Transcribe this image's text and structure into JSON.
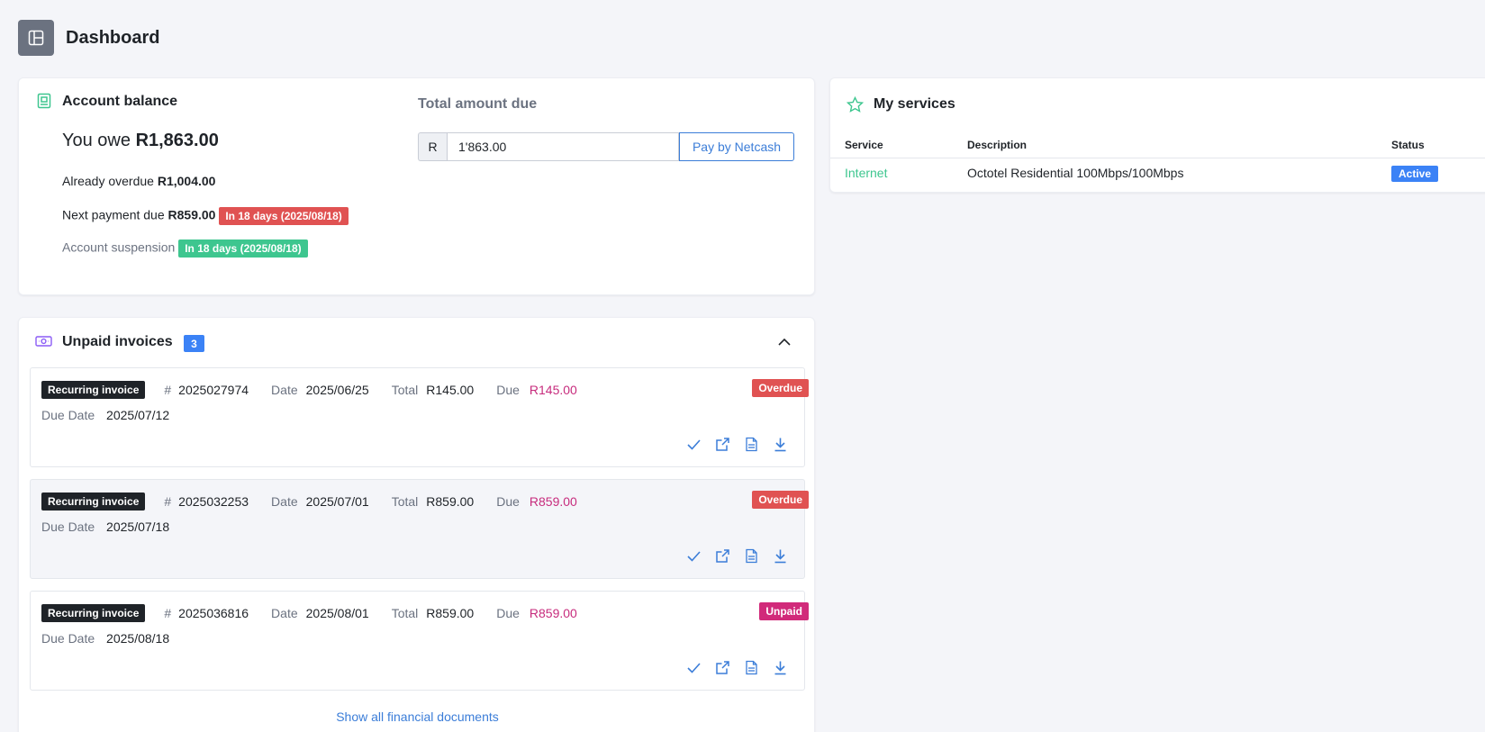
{
  "page": {
    "title": "Dashboard"
  },
  "balance": {
    "title": "Account balance",
    "owe_prefix": "You owe",
    "owe_amount": "R1,863.00",
    "overdue_label": "Already overdue",
    "overdue_amount": "R1,004.00",
    "next_label": "Next payment due",
    "next_amount": "R859.00",
    "next_tag": "In 18 days (2025/08/18)",
    "suspension_label": "Account suspension",
    "suspension_tag": "In 18 days (2025/08/18)",
    "total_due_label": "Total amount due",
    "currency_prefix": "R",
    "amount_value": "1'863.00",
    "pay_button": "Pay by Netcash"
  },
  "invoices": {
    "title": "Unpaid invoices",
    "count": "3",
    "labels": {
      "number": "#",
      "date": "Date",
      "total": "Total",
      "due": "Due",
      "due_date": "Due Date"
    },
    "items": [
      {
        "type": "Recurring invoice",
        "number": "2025027974",
        "date": "2025/06/25",
        "total": "R145.00",
        "due": "R145.00",
        "due_date": "2025/07/12",
        "status": "Overdue",
        "status_color": "#e05252"
      },
      {
        "type": "Recurring invoice",
        "number": "2025032253",
        "date": "2025/07/01",
        "total": "R859.00",
        "due": "R859.00",
        "due_date": "2025/07/18",
        "status": "Overdue",
        "status_color": "#e05252"
      },
      {
        "type": "Recurring invoice",
        "number": "2025036816",
        "date": "2025/08/01",
        "total": "R859.00",
        "due": "R859.00",
        "due_date": "2025/08/18",
        "status": "Unpaid",
        "status_color": "#d12a7a"
      }
    ],
    "actions": [
      "check-icon",
      "external-link-icon",
      "pdf-icon",
      "download-icon"
    ],
    "show_all": "Show all financial documents"
  },
  "services": {
    "title": "My services",
    "columns": [
      "Service",
      "Description",
      "Status"
    ],
    "rows": [
      {
        "service": "Internet",
        "description": "Octotel Residential 100Mbps/100Mbps",
        "status": "Active"
      }
    ]
  },
  "colors": {
    "accent": "#3b7dd8",
    "green": "#3ec68f",
    "red": "#e05252",
    "pink": "#d12a7a",
    "badge_blue": "#3b82f6"
  }
}
